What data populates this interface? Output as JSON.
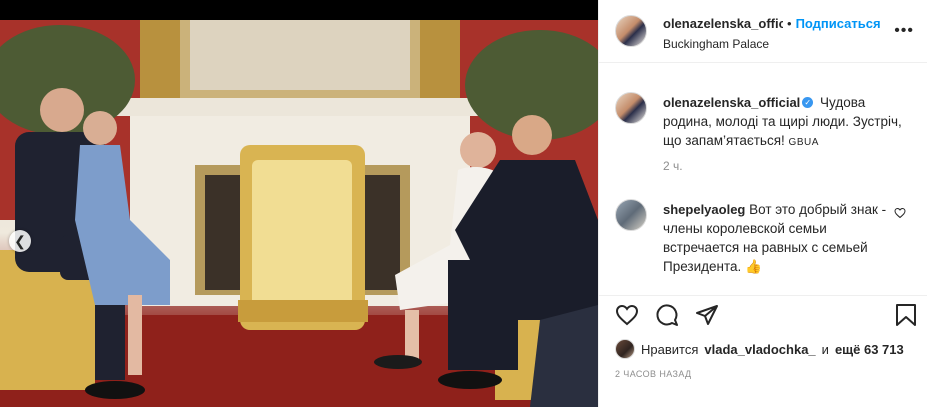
{
  "post": {
    "username": "olenazelenska_official",
    "username_short": "olenazelenska_offic",
    "follow_label": "Подписаться",
    "location": "Buckingham Palace",
    "more_icon": "ellipsis-icon"
  },
  "caption": {
    "username": "olenazelenska_official",
    "text": "Чудова родина, молоді та щирі люди. Зустріч, що запам’ятається!",
    "tag": "GBUA",
    "time": "2 ч."
  },
  "comment": {
    "username": "shepelyaoleg",
    "text": "Вот это добрый знак - члены королевской семьи встречается на равных с семьей Президента.",
    "emoji": "👍"
  },
  "likes": {
    "prefix": "Нравится",
    "user": "vlada_vladochka_",
    "conj": "и",
    "others": "ещё 63 713"
  },
  "age": "2 ЧАСОВ НАЗАД",
  "carousel": {
    "slides": 2,
    "active": 2
  },
  "colors": {
    "accent": "#0095f6",
    "verified": "#3897f0",
    "muted": "#8e8e8e",
    "text": "#262626"
  }
}
